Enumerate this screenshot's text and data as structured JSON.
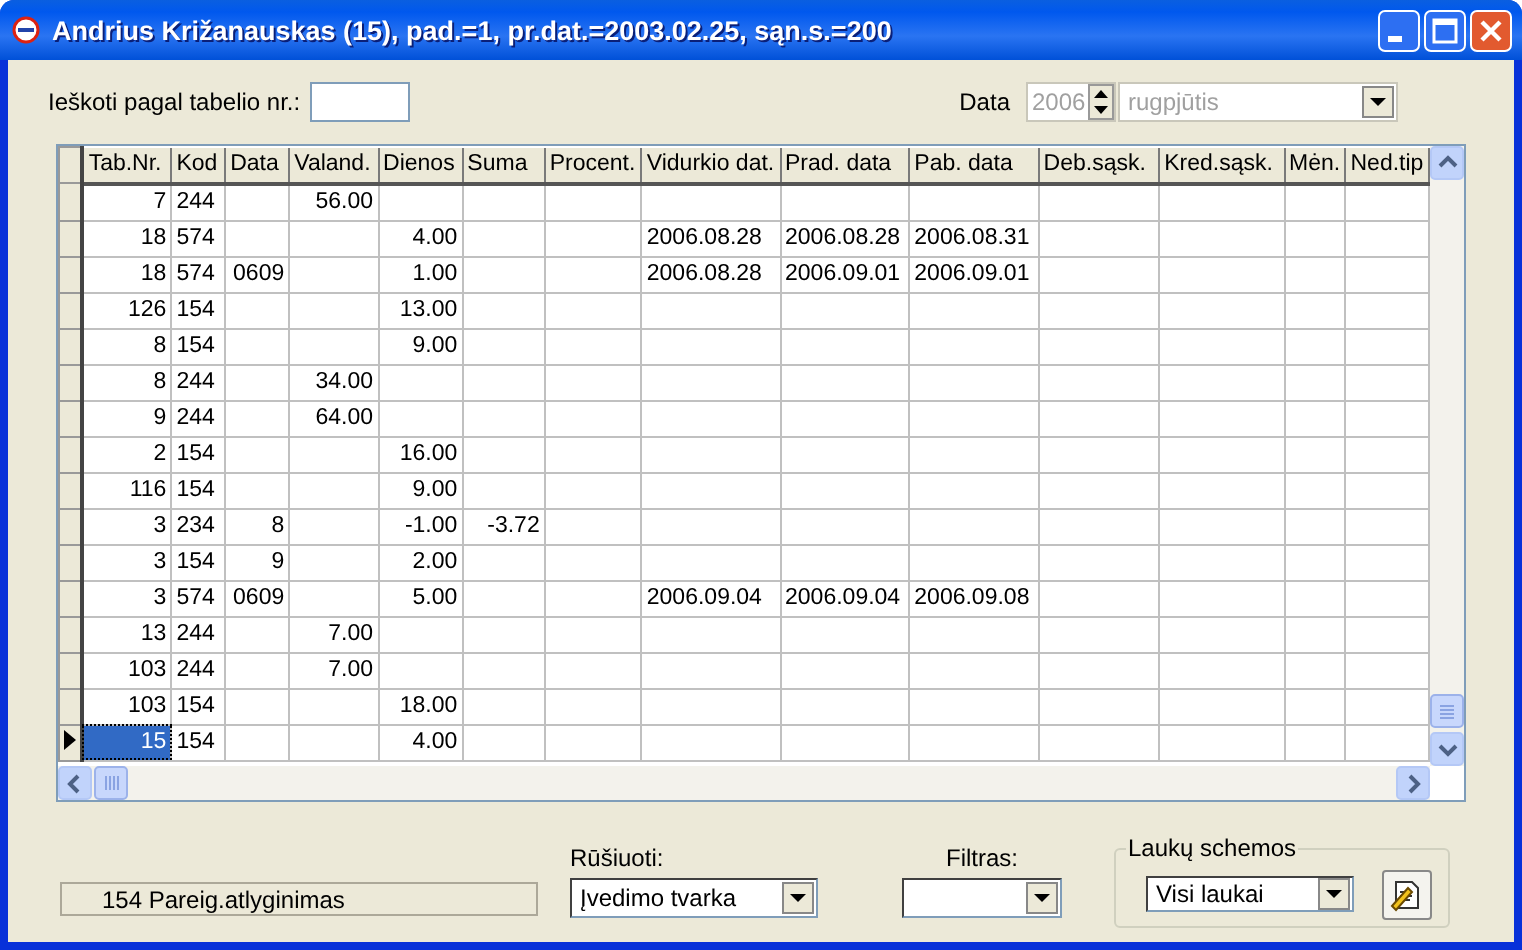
{
  "window": {
    "title": "Andrius Križanauskas (15), pad.=1, pr.dat.=2003.02.25, sąn.s.=200"
  },
  "search": {
    "label": "Ieškoti pagal tabelio nr.:"
  },
  "date": {
    "label": "Data",
    "year": "2006",
    "month": "rugpjūtis",
    "disabled": true
  },
  "table": {
    "columns": [
      "Tab.Nr.",
      "Kod",
      "Data",
      "Valand.",
      "Dienos",
      "Suma",
      "Procent.",
      "Vidurkio dat.",
      "Prad. data",
      "Pab. data",
      "Deb.sąsk.",
      "Kred.sąsk.",
      "Mėn.",
      "Ned.tip"
    ],
    "rows": [
      {
        "selected": false,
        "cells": [
          "7",
          "244",
          null,
          "56.00",
          null,
          null,
          null,
          null,
          null,
          null,
          null,
          null,
          null,
          null
        ]
      },
      {
        "selected": false,
        "cells": [
          "18",
          "574",
          null,
          null,
          "4.00",
          null,
          null,
          "2006.08.28",
          "2006.08.28",
          "2006.08.31",
          null,
          null,
          null,
          null
        ]
      },
      {
        "selected": false,
        "cells": [
          "18",
          "574",
          "0609",
          null,
          "1.00",
          null,
          null,
          "2006.08.28",
          "2006.09.01",
          "2006.09.01",
          null,
          null,
          null,
          null
        ]
      },
      {
        "selected": false,
        "cells": [
          "126",
          "154",
          null,
          null,
          "13.00",
          null,
          null,
          null,
          null,
          null,
          null,
          null,
          null,
          null
        ]
      },
      {
        "selected": false,
        "cells": [
          "8",
          "154",
          null,
          null,
          "9.00",
          null,
          null,
          null,
          null,
          null,
          null,
          null,
          null,
          null
        ]
      },
      {
        "selected": false,
        "cells": [
          "8",
          "244",
          null,
          "34.00",
          null,
          null,
          null,
          null,
          null,
          null,
          null,
          null,
          null,
          null
        ]
      },
      {
        "selected": false,
        "cells": [
          "9",
          "244",
          null,
          "64.00",
          null,
          null,
          null,
          null,
          null,
          null,
          null,
          null,
          null,
          null
        ]
      },
      {
        "selected": false,
        "cells": [
          "2",
          "154",
          null,
          null,
          "16.00",
          null,
          null,
          null,
          null,
          null,
          null,
          null,
          null,
          null
        ]
      },
      {
        "selected": false,
        "cells": [
          "116",
          "154",
          null,
          null,
          "9.00",
          null,
          null,
          null,
          null,
          null,
          null,
          null,
          null,
          null
        ]
      },
      {
        "selected": false,
        "cells": [
          "3",
          "234",
          "8",
          null,
          "-1.00",
          "-3.72",
          null,
          null,
          null,
          null,
          null,
          null,
          null,
          null
        ]
      },
      {
        "selected": false,
        "cells": [
          "3",
          "154",
          "9",
          null,
          "2.00",
          null,
          null,
          null,
          null,
          null,
          null,
          null,
          null,
          null
        ]
      },
      {
        "selected": false,
        "cells": [
          "3",
          "574",
          "0609",
          null,
          "5.00",
          null,
          null,
          "2006.09.04",
          "2006.09.04",
          "2006.09.08",
          null,
          null,
          null,
          null
        ]
      },
      {
        "selected": false,
        "cells": [
          "13",
          "244",
          null,
          "7.00",
          null,
          null,
          null,
          null,
          null,
          null,
          null,
          null,
          null,
          null
        ]
      },
      {
        "selected": false,
        "cells": [
          "103",
          "244",
          null,
          "7.00",
          null,
          null,
          null,
          null,
          null,
          null,
          null,
          null,
          null,
          null
        ]
      },
      {
        "selected": false,
        "cells": [
          "103",
          "154",
          null,
          null,
          "18.00",
          null,
          null,
          null,
          null,
          null,
          null,
          null,
          null,
          null
        ]
      },
      {
        "selected": true,
        "cells": [
          "15",
          "154",
          null,
          null,
          "4.00",
          null,
          null,
          null,
          null,
          null,
          null,
          null,
          null,
          null
        ]
      }
    ]
  },
  "status": "154 Pareig.atlyginimas",
  "sort": {
    "label": "Rūšiuoti:",
    "value": "Įvedimo tvarka"
  },
  "filter": {
    "label": "Filtras:"
  },
  "field_schemes": {
    "label": "Laukų schemos",
    "value": "Visi laukai"
  }
}
